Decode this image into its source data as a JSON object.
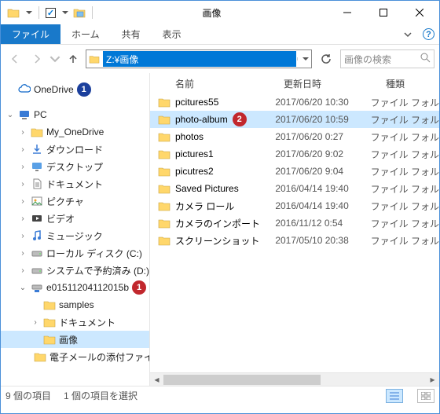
{
  "title": "画像",
  "qat": {
    "checked": true
  },
  "ribbon": {
    "file": "ファイル",
    "tabs": [
      "ホーム",
      "共有",
      "表示"
    ]
  },
  "nav": {
    "address": "Z:¥画像",
    "search_placeholder": "画像の検索"
  },
  "tree": [
    {
      "id": "onedrive",
      "label": "OneDrive",
      "depth": 0,
      "exp": "",
      "icon": "cloud",
      "badge": "blue",
      "badgeNum": "1"
    },
    {
      "id": "spacer",
      "label": "",
      "depth": 0,
      "spacer": true
    },
    {
      "id": "pc",
      "label": "PC",
      "depth": 0,
      "exp": "v",
      "icon": "pc"
    },
    {
      "id": "myod",
      "label": "My_OneDrive",
      "depth": 1,
      "exp": ">",
      "icon": "folder"
    },
    {
      "id": "downloads",
      "label": "ダウンロード",
      "depth": 1,
      "exp": ">",
      "icon": "downloads"
    },
    {
      "id": "desktop",
      "label": "デスクトップ",
      "depth": 1,
      "exp": ">",
      "icon": "desktop"
    },
    {
      "id": "documents",
      "label": "ドキュメント",
      "depth": 1,
      "exp": ">",
      "icon": "documents"
    },
    {
      "id": "pictures",
      "label": "ピクチャ",
      "depth": 1,
      "exp": ">",
      "icon": "pictures"
    },
    {
      "id": "videos",
      "label": "ビデオ",
      "depth": 1,
      "exp": ">",
      "icon": "videos"
    },
    {
      "id": "music",
      "label": "ミュージック",
      "depth": 1,
      "exp": ">",
      "icon": "music"
    },
    {
      "id": "localc",
      "label": "ローカル ディスク (C:)",
      "depth": 1,
      "exp": ">",
      "icon": "drive"
    },
    {
      "id": "sysres",
      "label": "システムで予約済み (D:)",
      "depth": 1,
      "exp": ">",
      "icon": "drive"
    },
    {
      "id": "netdrv",
      "label": "e01511204112015b",
      "depth": 1,
      "exp": "v",
      "icon": "netdrive",
      "badge": "red",
      "badgeNum": "1"
    },
    {
      "id": "samples",
      "label": "samples",
      "depth": 2,
      "exp": "",
      "icon": "folder"
    },
    {
      "id": "docs2",
      "label": "ドキュメント",
      "depth": 2,
      "exp": ">",
      "icon": "folder"
    },
    {
      "id": "gazou",
      "label": "画像",
      "depth": 2,
      "exp": "",
      "icon": "folder",
      "selected": true
    },
    {
      "id": "mail",
      "label": "電子メールの添付ファイ",
      "depth": 2,
      "exp": "",
      "icon": "folder"
    }
  ],
  "cols": {
    "name": "名前",
    "date": "更新日時",
    "type": "種類"
  },
  "rows": [
    {
      "name": "pcitures55",
      "date": "2017/06/20 10:30",
      "type": "ファイル フォル"
    },
    {
      "name": "photo-album",
      "date": "2017/06/20 10:59",
      "type": "ファイル フォル",
      "selected": true,
      "badge": "red",
      "badgeNum": "2"
    },
    {
      "name": "photos",
      "date": "2017/06/20 0:27",
      "type": "ファイル フォル"
    },
    {
      "name": "pictures1",
      "date": "2017/06/20 9:02",
      "type": "ファイル フォル"
    },
    {
      "name": "picutres2",
      "date": "2017/06/20 9:04",
      "type": "ファイル フォル"
    },
    {
      "name": "Saved Pictures",
      "date": "2016/04/14 19:40",
      "type": "ファイル フォル"
    },
    {
      "name": "カメラ ロール",
      "date": "2016/04/14 19:40",
      "type": "ファイル フォル"
    },
    {
      "name": "カメラのインポート",
      "date": "2016/11/12 0:54",
      "type": "ファイル フォル"
    },
    {
      "name": "スクリーンショット",
      "date": "2017/05/10 20:38",
      "type": "ファイル フォル"
    }
  ],
  "status": {
    "count": "9 個の項目",
    "selected": "1 個の項目を選択"
  }
}
